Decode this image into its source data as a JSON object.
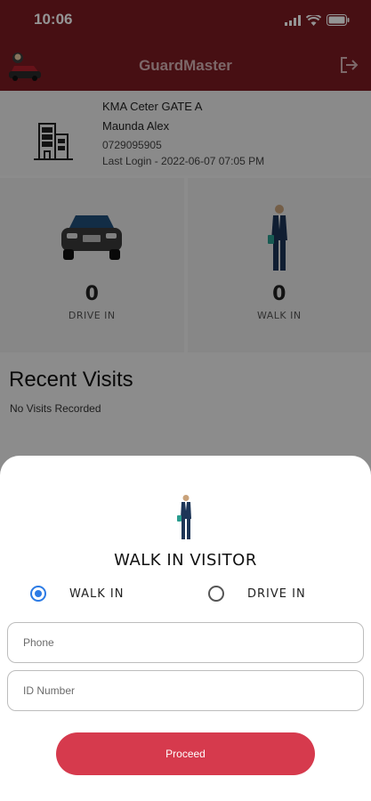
{
  "status_bar": {
    "time": "10:06"
  },
  "app_bar": {
    "title": "GuardMaster"
  },
  "profile": {
    "gate": "KMA Ceter GATE A",
    "name": "Maunda Alex",
    "phone": "0729095905",
    "last_login": "Last Login - 2022-06-07 07:05 PM"
  },
  "stats": [
    {
      "count": "0",
      "label": "DRIVE IN",
      "icon": "car-icon"
    },
    {
      "count": "0",
      "label": "WALK IN",
      "icon": "walking-man-icon"
    }
  ],
  "recent": {
    "title": "Recent Visits",
    "empty_text": "No Visits Recorded"
  },
  "sheet": {
    "title": "WALK IN VISITOR",
    "options": [
      {
        "label": "WALK IN",
        "selected": true
      },
      {
        "label": "DRIVE IN",
        "selected": false
      }
    ],
    "phone_placeholder": "Phone",
    "id_placeholder": "ID Number",
    "proceed_label": "Proceed"
  },
  "colors": {
    "header": "#7a1a22",
    "accent": "#d63a4d",
    "radio": "#2c7be5"
  }
}
